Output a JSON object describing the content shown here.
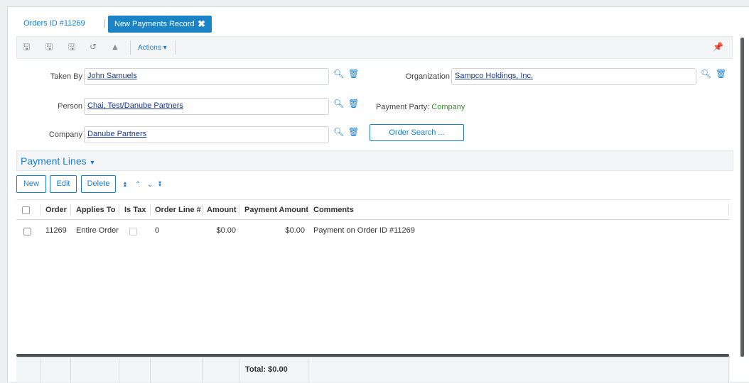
{
  "tabs": {
    "orders_tab": "Orders ID #11269",
    "active_tab": "New Payments Record"
  },
  "toolbar": {
    "actions_label": "Actions ▾"
  },
  "form": {
    "taken_by_label": "Taken By",
    "taken_by_value": "John Samuels",
    "organization_label": "Organization",
    "organization_value": "Sampco Holdings, Inc.",
    "person_label": "Person",
    "person_value": "Chai, Test/Danube Partners",
    "payment_party_label": "Payment Party:",
    "payment_party_value": "Company",
    "company_label": "Company",
    "company_value": "Danube Partners",
    "order_search_label": "Order Search ..."
  },
  "payment_lines": {
    "title": "Payment Lines",
    "buttons": {
      "new": "New",
      "edit": "Edit",
      "delete": "Delete"
    },
    "columns": [
      "Order",
      "Applies To",
      "Is Tax",
      "Order Line #",
      "Amount",
      "Payment Amount",
      "Comments"
    ],
    "rows": [
      {
        "order": "11269",
        "applies_to": "Entire Order",
        "is_tax": false,
        "order_line": "0",
        "amount": "$0.00",
        "payment_amount": "$0.00",
        "comments": "Payment on Order ID #11269"
      }
    ],
    "total": "Total: $0.00"
  },
  "colors": {
    "accent": "#1a84c7",
    "link": "#1a7ec9",
    "party_value": "#3a8a2e"
  }
}
